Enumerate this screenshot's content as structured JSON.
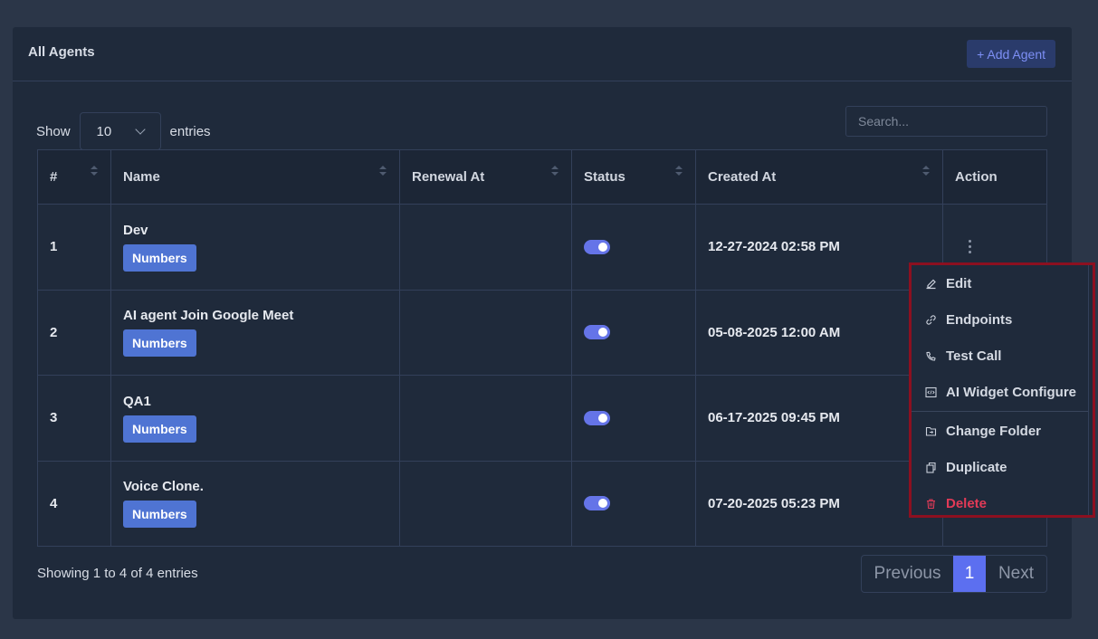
{
  "header": {
    "title": "All Agents",
    "add_button": "+ Add Agent"
  },
  "length": {
    "show_label": "Show",
    "value": "10",
    "entries_label": "entries"
  },
  "search": {
    "placeholder": "Search..."
  },
  "table": {
    "columns": [
      "#",
      "Name",
      "Renewal At",
      "Status",
      "Created At",
      "Action"
    ],
    "rows": [
      {
        "index": "1",
        "name": "Dev",
        "badge": "Numbers",
        "renewal": "",
        "status_on": true,
        "created": "12-27-2024 02:58 PM"
      },
      {
        "index": "2",
        "name": "AI agent Join Google Meet",
        "badge": "Numbers",
        "renewal": "",
        "status_on": true,
        "created": "05-08-2025 12:00 AM"
      },
      {
        "index": "3",
        "name": "QA1",
        "badge": "Numbers",
        "renewal": "",
        "status_on": true,
        "created": "06-17-2025 09:45 PM"
      },
      {
        "index": "4",
        "name": "Voice Clone.",
        "badge": "Numbers",
        "renewal": "",
        "status_on": true,
        "created": "07-20-2025 05:23 PM"
      }
    ]
  },
  "footer": {
    "info": "Showing 1 to 4 of 4 entries"
  },
  "pagination": {
    "previous": "Previous",
    "current": "1",
    "next": "Next"
  },
  "menu": {
    "items": [
      {
        "label": "Edit",
        "icon": "edit-icon"
      },
      {
        "label": "Endpoints",
        "icon": "link-icon"
      },
      {
        "label": "Test Call",
        "icon": "phone-icon"
      },
      {
        "label": "AI Widget Configure",
        "icon": "code-icon"
      },
      {
        "label": "Change Folder",
        "icon": "folder-icon"
      },
      {
        "label": "Duplicate",
        "icon": "copy-icon"
      },
      {
        "label": "Delete",
        "icon": "trash-icon"
      }
    ]
  },
  "colors": {
    "accent": "#5c6ff0",
    "badge": "#4f74d3",
    "danger": "#e23a57",
    "highlight_border": "#8c1020"
  }
}
